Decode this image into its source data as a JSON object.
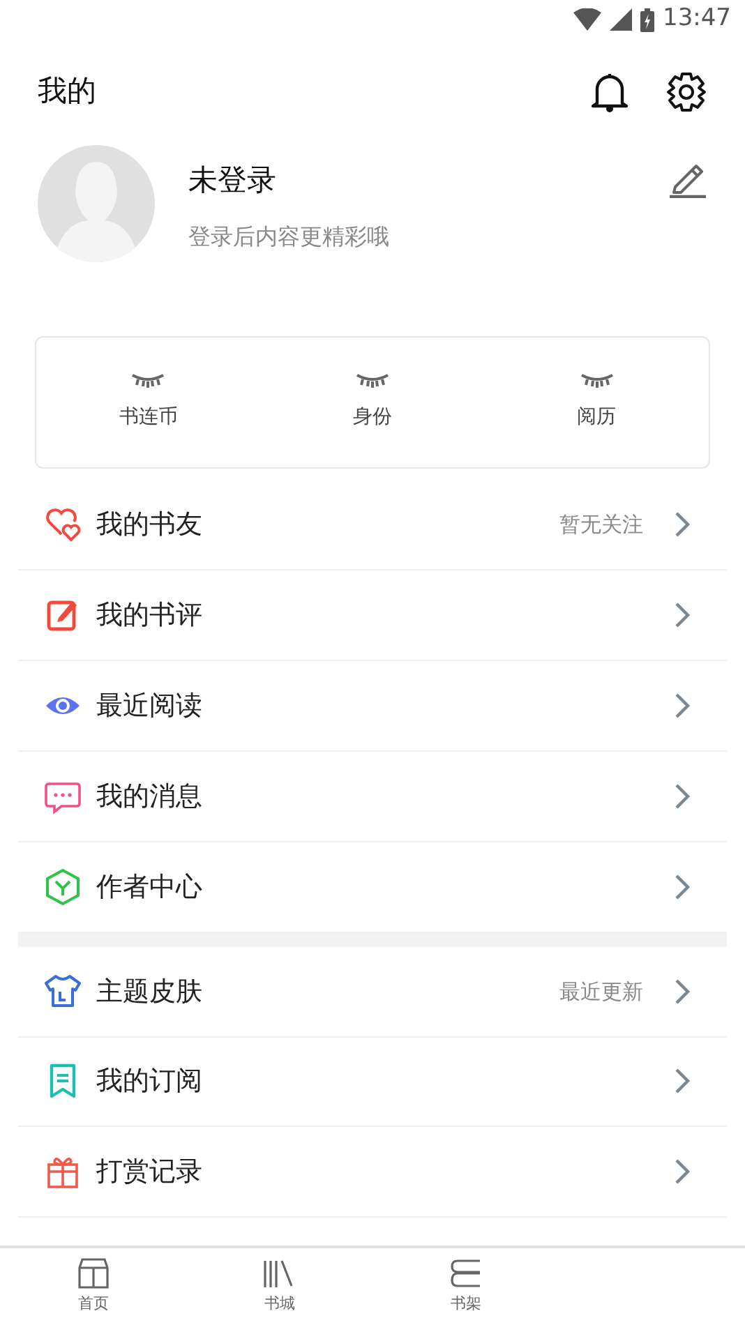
{
  "status_bar": {
    "time": "13:47"
  },
  "header": {
    "title": "我的"
  },
  "profile": {
    "name": "未登录",
    "subtitle": "登录后内容更精彩哦"
  },
  "stats": [
    {
      "label": "书连币"
    },
    {
      "label": "身份"
    },
    {
      "label": "阅历"
    }
  ],
  "menu_groups": [
    [
      {
        "kind": "friends",
        "label": "我的书友",
        "note": "暂无关注"
      },
      {
        "kind": "review",
        "label": "我的书评"
      },
      {
        "kind": "recent",
        "label": "最近阅读"
      },
      {
        "kind": "messages",
        "label": "我的消息"
      },
      {
        "kind": "author",
        "label": "作者中心"
      }
    ],
    [
      {
        "kind": "theme",
        "label": "主题皮肤",
        "note": "最近更新"
      },
      {
        "kind": "subscription",
        "label": "我的订阅"
      },
      {
        "kind": "reward",
        "label": "打赏记录"
      }
    ]
  ],
  "bottom_nav": [
    {
      "kind": "home",
      "label": "首页",
      "selected": false
    },
    {
      "kind": "store",
      "label": "书城",
      "selected": false
    },
    {
      "kind": "shelf",
      "label": "书架",
      "selected": false
    }
  ]
}
